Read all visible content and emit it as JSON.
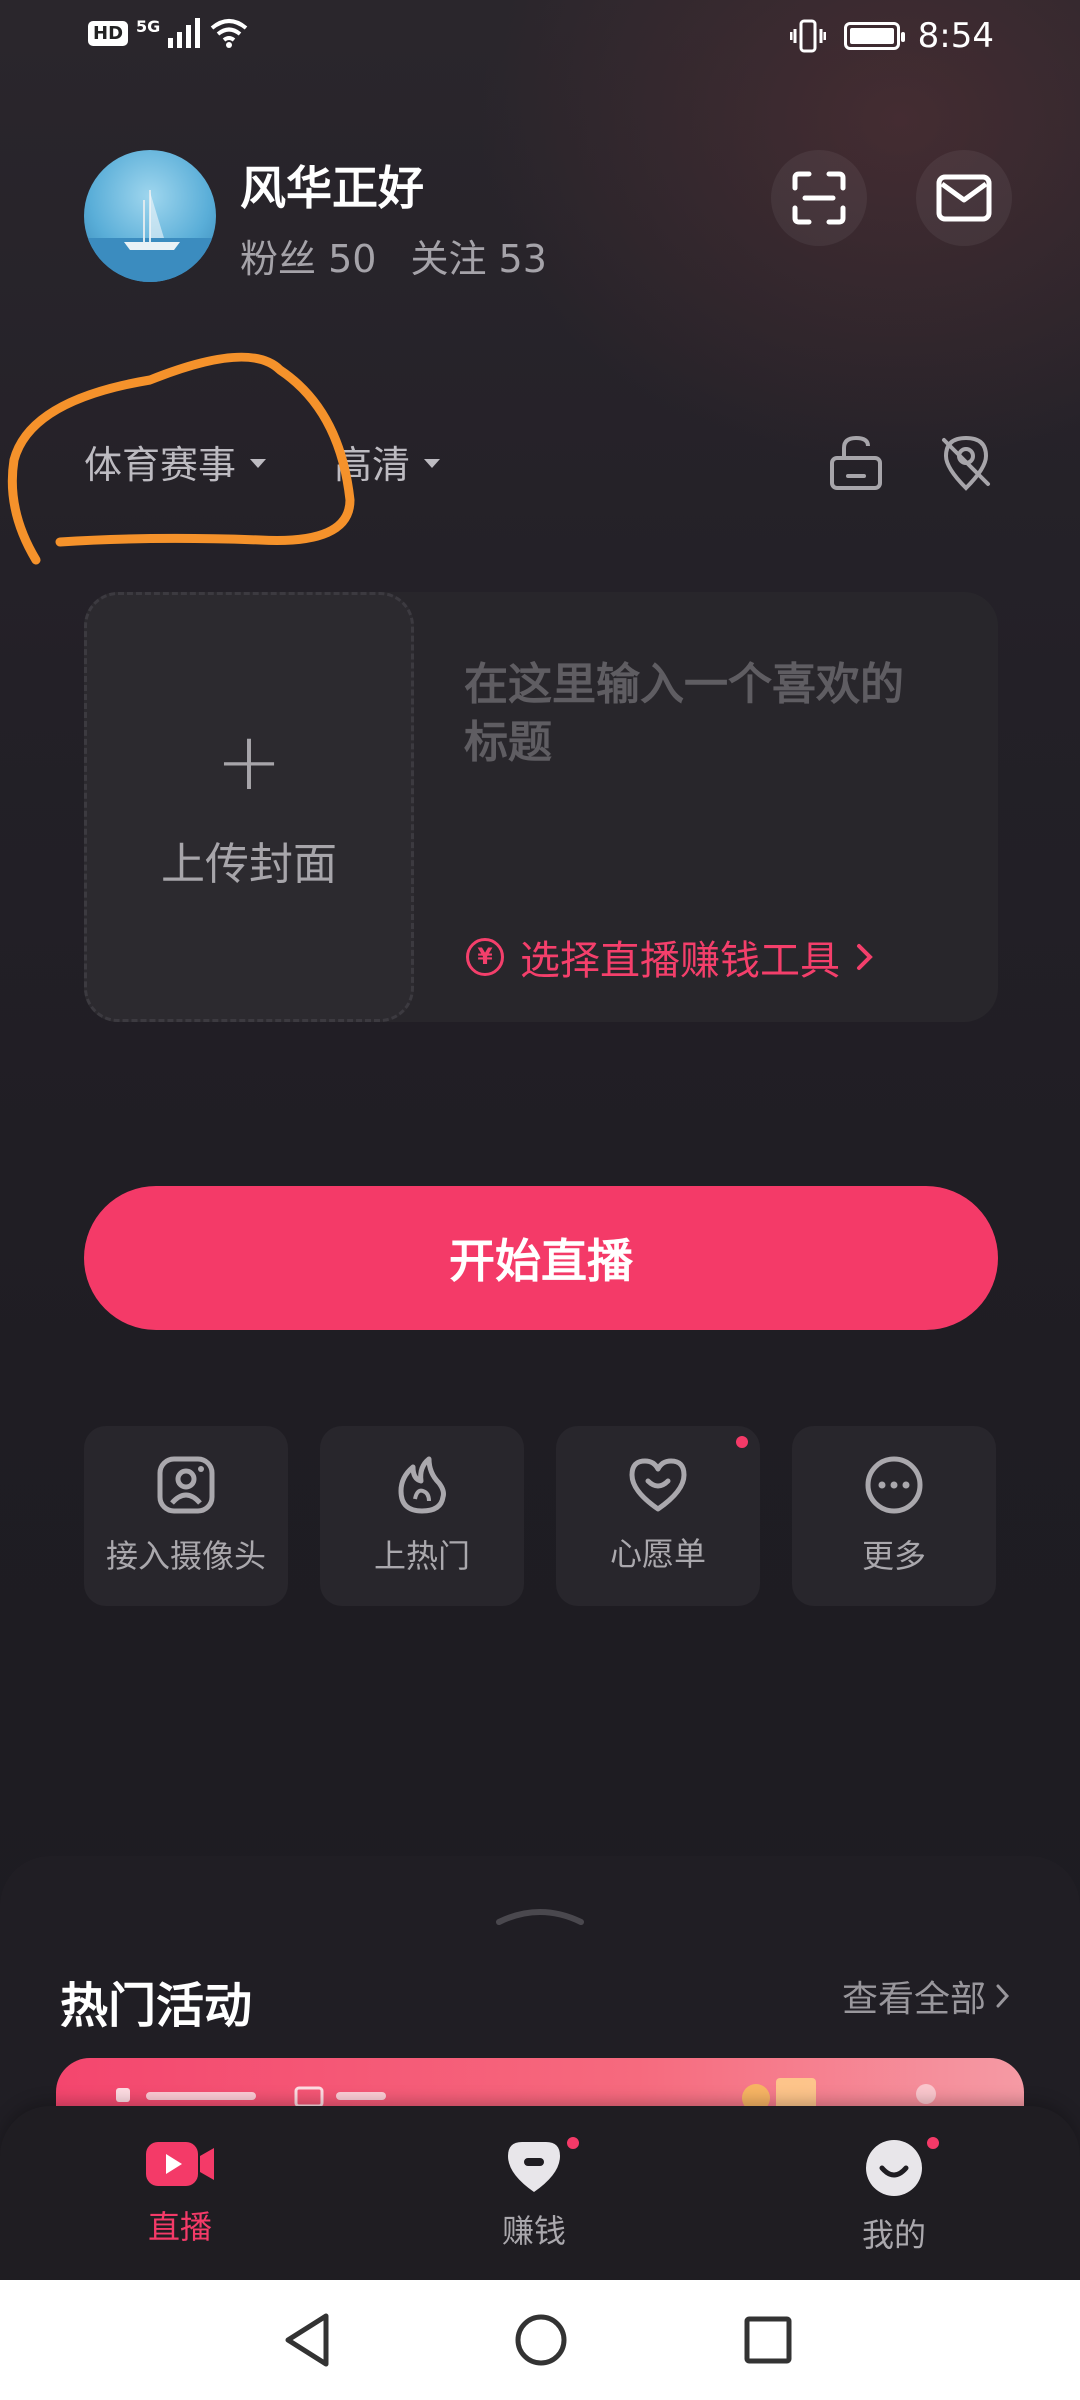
{
  "status_bar": {
    "hd": "HD",
    "network": "5G",
    "time": "8:54"
  },
  "profile": {
    "username": "风华正好",
    "fans_label": "粉丝 50",
    "following_label": "关注 53"
  },
  "options": {
    "category": "体育赛事",
    "quality": "高清"
  },
  "cover": {
    "upload_label": "上传封面",
    "title_placeholder": "在这里输入一个喜欢的标题",
    "tool_link": "选择直播赚钱工具",
    "tool_icon": "¥"
  },
  "start_button": "开始直播",
  "features": [
    {
      "label": "接入摄像头",
      "icon": "camera-icon"
    },
    {
      "label": "上热门",
      "icon": "flame-icon"
    },
    {
      "label": "心愿单",
      "icon": "heart-icon",
      "badge": true
    },
    {
      "label": "更多",
      "icon": "more-icon"
    }
  ],
  "hot_section": {
    "title": "热门活动",
    "view_all": "查看全部"
  },
  "bottom_nav": [
    {
      "label": "直播",
      "icon": "live-camera-icon",
      "active": true
    },
    {
      "label": "赚钱",
      "icon": "earn-icon",
      "badge": true
    },
    {
      "label": "我的",
      "icon": "profile-smile-icon",
      "badge": true
    }
  ],
  "colors": {
    "accent": "#f43a68",
    "background": "#1e1c22",
    "annotation": "#f5922b"
  }
}
